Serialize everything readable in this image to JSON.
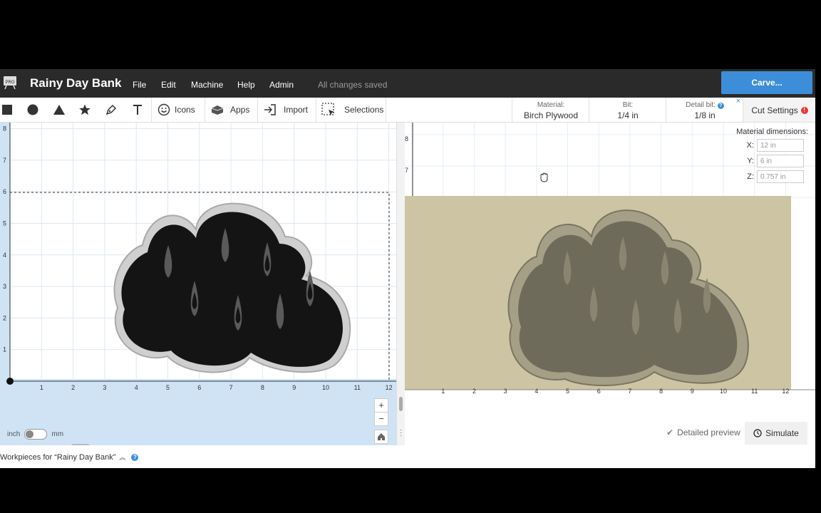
{
  "header": {
    "title": "Rainy Day Bank",
    "logo_badge": "PRO",
    "menu": [
      "File",
      "Edit",
      "Machine",
      "Help",
      "Admin"
    ],
    "status": "All changes saved",
    "carve_label": "Carve..."
  },
  "toolbar": {
    "icons_label": "Icons",
    "apps_label": "Apps",
    "import_label": "Import",
    "selections_label": "Selections"
  },
  "settings": {
    "material_key": "Material:",
    "material_value": "Birch Plywood",
    "bit_key": "Bit:",
    "bit_value": "1/4 in",
    "detail_key": "Detail bit:",
    "detail_value": "1/8 in",
    "cut_settings_label": "Cut Settings"
  },
  "material_dimensions": {
    "label": "Material dimensions:",
    "x_label": "X:",
    "x_value": "12 in",
    "y_label": "Y:",
    "y_value": "6 in",
    "z_label": "Z:",
    "z_value": "0.757 in"
  },
  "left_canvas": {
    "y_ticks": [
      "8",
      "7",
      "6",
      "5",
      "4",
      "3",
      "2",
      "1"
    ],
    "x_ticks": [
      "1",
      "2",
      "3",
      "4",
      "5",
      "6",
      "7",
      "8",
      "9",
      "10",
      "11",
      "12"
    ]
  },
  "right_canvas": {
    "y_ticks": [
      "8",
      "7"
    ],
    "x_ticks": [
      "1",
      "2",
      "3",
      "4",
      "5",
      "6",
      "7",
      "8",
      "9",
      "10",
      "11",
      "12"
    ]
  },
  "units": {
    "left": "inch",
    "right": "mm"
  },
  "zoom": {
    "in": "+",
    "out": "−"
  },
  "preview": {
    "detailed_label": "Detailed preview",
    "simulate_label": "Simulate"
  },
  "workpieces_label": "Workpieces for “Rainy Day Bank”",
  "colors": {
    "accent": "#3d8ed8",
    "topbar": "#2a2a2a",
    "canvas_bg": "#cfe3f5",
    "wood": "#cdc4a4"
  }
}
